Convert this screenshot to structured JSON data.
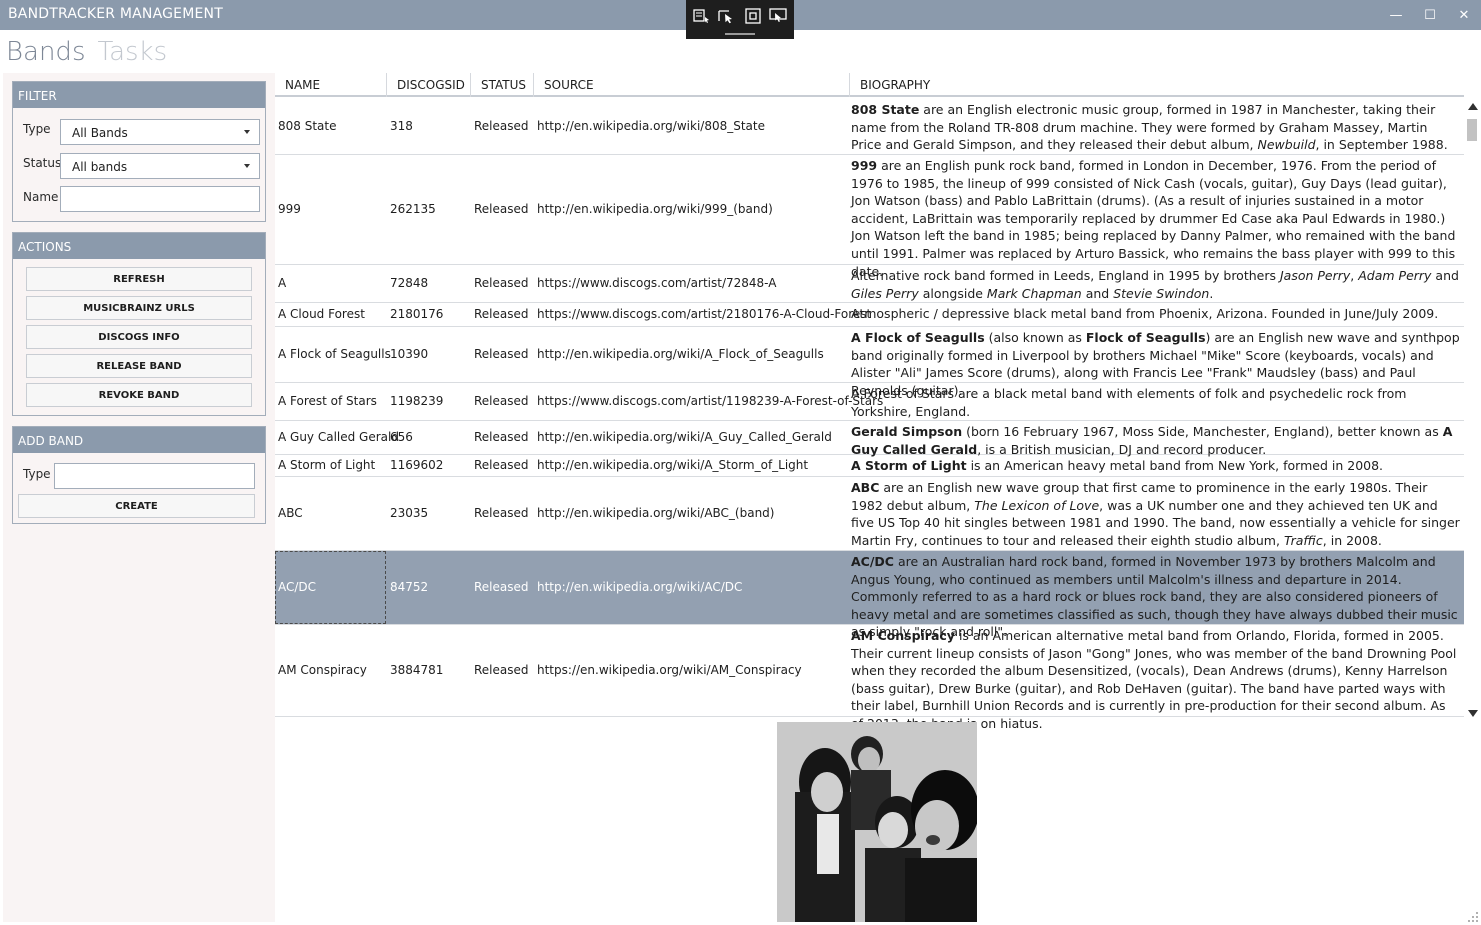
{
  "window": {
    "title": "BANDTRACKER MANAGEMENT",
    "minimize_glyph": "—",
    "maximize_glyph": "☐",
    "close_glyph": "✕"
  },
  "tabs": [
    {
      "label": "Bands"
    },
    {
      "label": "Tasks"
    }
  ],
  "filter": {
    "heading": "FILTER",
    "type_label": "Type",
    "type_value": "All Bands",
    "status_label": "Status",
    "status_value": "All bands",
    "name_label": "Name",
    "name_value": ""
  },
  "actions": {
    "heading": "ACTIONS",
    "buttons": [
      "REFRESH",
      "MUSICBRAINZ URLS",
      "DISCOGS INFO",
      "RELEASE BAND",
      "REVOKE BAND"
    ]
  },
  "add_band": {
    "heading": "ADD BAND",
    "type_label": "Type",
    "type_value": "",
    "create_label": "CREATE"
  },
  "grid": {
    "columns": [
      "NAME",
      "DISCOGSID",
      "STATUS",
      "SOURCE",
      "BIOGRAPHY"
    ],
    "rows": [
      {
        "name": "808 State",
        "discogsid": "318",
        "status": "Released",
        "source": "http://en.wikipedia.org/wiki/808_State",
        "bio": [
          {
            "t": "808 State",
            "b": true
          },
          {
            "t": " are an English electronic music group, formed in 1987 in Manchester, taking their name from the Roland TR-808 drum machine. They were formed by Graham Massey, Martin Price and Gerald Simpson, and they released their debut album, "
          },
          {
            "t": "Newbuild",
            "i": true
          },
          {
            "t": ", in September 1988."
          }
        ]
      },
      {
        "name": "999",
        "discogsid": "262135",
        "status": "Released",
        "source": "http://en.wikipedia.org/wiki/999_(band)",
        "bio": [
          {
            "t": "999",
            "b": true
          },
          {
            "t": " are an English punk rock band, formed in London in December, 1976. From the period of 1976 to 1985, the lineup of 999 consisted of Nick Cash (vocals, guitar), Guy Days (lead guitar), Jon Watson (bass) and Pablo LaBrittain (drums). (As a result of injuries sustained in a motor accident, LaBrittain was temporarily replaced by drummer Ed Case aka Paul Edwards in 1980.) Jon Watson left the band in 1985; being replaced by Danny Palmer, who remained with the band until 1991. Palmer was replaced by Arturo Bassick, who remains the bass player with 999 to this date."
          }
        ]
      },
      {
        "name": "A",
        "discogsid": "72848",
        "status": "Released",
        "source": "https://www.discogs.com/artist/72848-A",
        "bio": [
          {
            "t": "Alternative rock band formed in Leeds, England in 1995 by brothers "
          },
          {
            "t": "Jason Perry",
            "i": true
          },
          {
            "t": ", "
          },
          {
            "t": "Adam Perry",
            "i": true
          },
          {
            "t": " and "
          },
          {
            "t": "Giles Perry",
            "i": true
          },
          {
            "t": " alongside "
          },
          {
            "t": "Mark Chapman",
            "i": true
          },
          {
            "t": " and "
          },
          {
            "t": "Stevie Swindon",
            "i": true
          },
          {
            "t": "."
          }
        ]
      },
      {
        "name": "A Cloud Forest",
        "discogsid": "2180176",
        "status": "Released",
        "source": "https://www.discogs.com/artist/2180176-A-Cloud-Forest",
        "bio": [
          {
            "t": "Atmospheric / depressive black metal band from Phoenix, Arizona. Founded in June/July 2009."
          }
        ]
      },
      {
        "name": "A Flock of Seagulls",
        "discogsid": "10390",
        "status": "Released",
        "source": "http://en.wikipedia.org/wiki/A_Flock_of_Seagulls",
        "bio": [
          {
            "t": "A Flock of Seagulls",
            "b": true
          },
          {
            "t": " (also known as "
          },
          {
            "t": "Flock of Seagulls",
            "b": true
          },
          {
            "t": ") are an English new wave and synthpop band originally formed in Liverpool by brothers Michael \"Mike\" Score (keyboards, vocals) and Alister \"Ali\" James Score (drums), along with Francis Lee \"Frank\" Maudsley (bass) and Paul Reynolds (guitar)."
          }
        ]
      },
      {
        "name": "A Forest of Stars",
        "discogsid": "1198239",
        "status": "Released",
        "source": "https://www.discogs.com/artist/1198239-A-Forest-of-Stars",
        "bio": [
          {
            "t": "A Forest of Stars are a black metal band with elements of folk and psychedelic rock from Yorkshire, England."
          }
        ]
      },
      {
        "name": "A Guy Called Gerald",
        "discogsid": "656",
        "status": "Released",
        "source": "http://en.wikipedia.org/wiki/A_Guy_Called_Gerald",
        "bio": [
          {
            "t": "Gerald Simpson",
            "b": true
          },
          {
            "t": " (born 16 February 1967, Moss Side, Manchester, England), better known as "
          },
          {
            "t": "A Guy Called Gerald",
            "b": true
          },
          {
            "t": ", is a British musician, DJ and record producer."
          }
        ]
      },
      {
        "name": "A Storm of Light",
        "discogsid": "1169602",
        "status": "Released",
        "source": "http://en.wikipedia.org/wiki/A_Storm_of_Light",
        "bio": [
          {
            "t": "A Storm of Light",
            "b": true
          },
          {
            "t": " is an American heavy metal band from New York, formed in 2008."
          }
        ]
      },
      {
        "name": "ABC",
        "discogsid": "23035",
        "status": "Released",
        "source": "http://en.wikipedia.org/wiki/ABC_(band)",
        "bio": [
          {
            "t": "ABC",
            "b": true
          },
          {
            "t": " are an English new wave group that first came to prominence in the early 1980s. Their 1982 debut album, "
          },
          {
            "t": "The Lexicon of Love",
            "i": true
          },
          {
            "t": ", was a UK number one and they achieved ten UK and five US Top 40 hit singles between 1981 and 1990. The band, now essentially a vehicle for singer Martin Fry, continues to tour and released their eighth studio album, "
          },
          {
            "t": "Traffic",
            "i": true
          },
          {
            "t": ", in 2008."
          }
        ]
      },
      {
        "name": "AC/DC",
        "discogsid": "84752",
        "status": "Released",
        "source": "http://en.wikipedia.org/wiki/AC/DC",
        "selected": true,
        "bio": [
          {
            "t": "AC/DC",
            "b": true
          },
          {
            "t": " are an Australian hard rock band, formed in November 1973 by brothers Malcolm and Angus Young, who continued as members until Malcolm's illness and departure in 2014. Commonly referred to as a hard rock or blues rock band, they are also considered pioneers of heavy metal and are sometimes classified as such, though they have always dubbed their music as simply \"rock and roll\"."
          }
        ]
      },
      {
        "name": "AM Conspiracy",
        "discogsid": "3884781",
        "status": "Released",
        "source": "https://en.wikipedia.org/wiki/AM_Conspiracy",
        "bio": [
          {
            "t": "AM Conspiracy",
            "b": true
          },
          {
            "t": " is an American alternative metal band from Orlando, Florida, formed in 2005. Their current lineup consists of Jason \"Gong\" Jones, who was member of the band Drowning Pool when they recorded the album Desensitized, (vocals), Dean Andrews (drums), Kenny Harrelson (bass guitar), Drew Burke (guitar), and Rob DeHaven (guitar). The band have parted ways with their label, Burnhill Union Records and is currently in pre-production for their second album. As of 2013, the band is on hiatus."
          }
        ]
      }
    ]
  },
  "colors": {
    "accent": "#8b9aac",
    "selection": "#93a0b1",
    "tab_active": "#7d8796",
    "tab_inactive": "#c3c8cf"
  }
}
